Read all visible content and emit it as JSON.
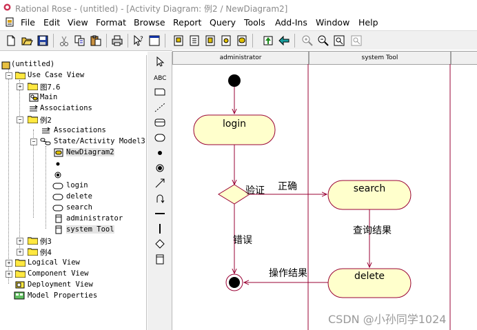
{
  "window": {
    "title": "Rational Rose - (untitled) - [Activity Diagram: 例2 / NewDiagram2]"
  },
  "menu": {
    "items": [
      "File",
      "Edit",
      "View",
      "Format",
      "Browse",
      "Report",
      "Query",
      "Tools",
      "Add-Ins",
      "Window",
      "Help"
    ]
  },
  "toolbar": {
    "icons": [
      "new-icon",
      "open-icon",
      "save-icon",
      "cut-icon",
      "copy-icon",
      "paste-icon",
      "print-icon",
      "context-help-icon",
      "view-doc-icon",
      "class-diagram-icon",
      "interaction-diagram-icon",
      "component-diagram-icon",
      "deployment-diagram-icon",
      "browse-parent-icon",
      "browse-previous-icon",
      "zoom-in-icon",
      "zoom-out-icon",
      "fit-window-icon",
      "undo-fit-icon"
    ]
  },
  "tree": {
    "root": "(untitled)",
    "use_case_view": "Use Case View",
    "fig76": "图7.6",
    "main": "Main",
    "associations": "Associations",
    "ex2": "例2",
    "ex2_associations": "Associations",
    "state_activity": "State/Activity Model3",
    "new_diagram2": "NewDiagram2",
    "login": "login",
    "delete": "delete",
    "search": "search",
    "administrator": "administrator",
    "system_tool": "system Tool",
    "ex3": "例3",
    "ex4": "例4",
    "logical_view": "Logical View",
    "component_view": "Component View",
    "deployment_view": "Deployment View",
    "model_properties": "Model Properties"
  },
  "palette": {
    "tools": [
      "selection-arrow-icon",
      "text-box-icon",
      "note-icon",
      "anchor-note-icon",
      "state-icon",
      "activity-icon",
      "start-state-icon",
      "end-state-icon",
      "transition-icon",
      "self-transition-icon",
      "horizontal-sync-icon",
      "vertical-sync-icon",
      "decision-icon",
      "swimlane-icon"
    ],
    "text_tool": "ABC"
  },
  "diagram": {
    "swimlanes": [
      "administrator",
      "system Tool"
    ],
    "activities": {
      "login": "login",
      "search": "search",
      "delete": "delete"
    },
    "decision_label": "验证",
    "transitions": {
      "correct": "正确",
      "error": "错误",
      "query_result": "查询结果",
      "op_result": "操作结果"
    }
  },
  "watermark": "CSDN @小孙同学1024",
  "colors": {
    "activity_fill": "#ffffcc",
    "activity_stroke": "#990033",
    "swimlane_line": "#990033"
  }
}
